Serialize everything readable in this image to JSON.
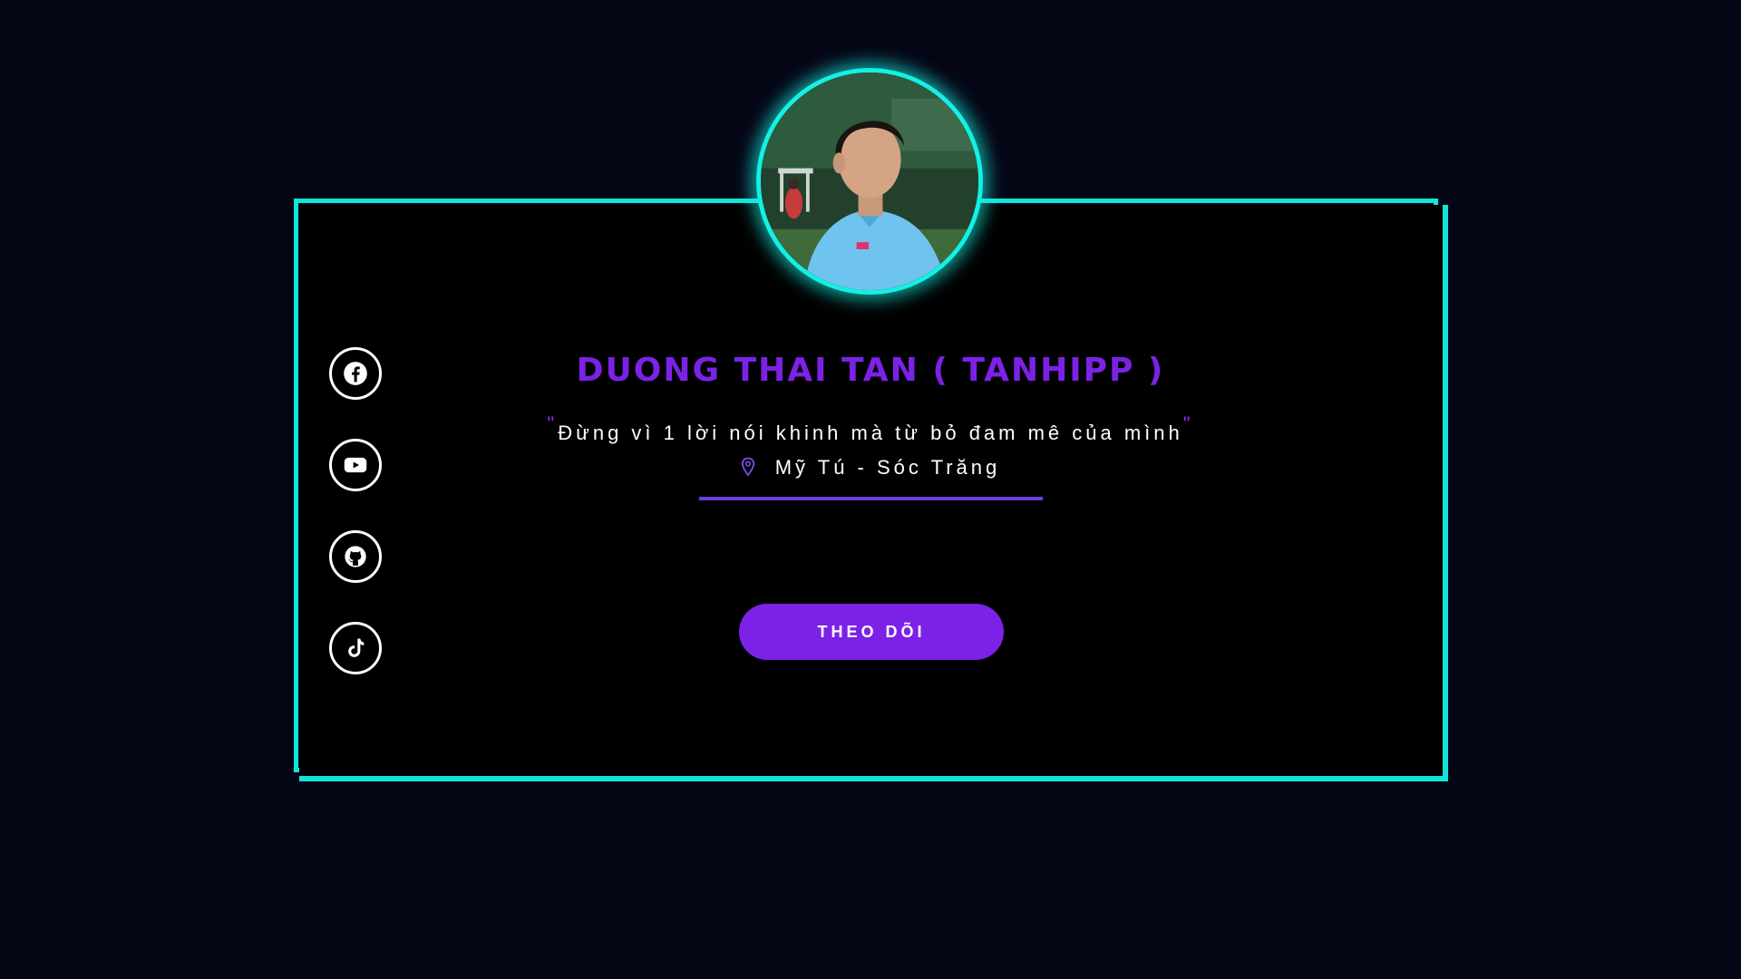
{
  "profile": {
    "name": "DUONG THAI TAN ( TANHIPP )",
    "quote_open": "\"",
    "quote": "Đừng vì 1 lời nói khinh mà từ bỏ đam mê của mình",
    "quote_close": "\"",
    "location": "Mỹ Tú - Sóc Trăng",
    "follow_label": "THEO DÕI"
  },
  "social": [
    {
      "name": "facebook-icon"
    },
    {
      "name": "youtube-icon"
    },
    {
      "name": "github-icon"
    },
    {
      "name": "tiktok-icon"
    }
  ],
  "colors": {
    "background": "#050615",
    "card": "#000000",
    "border": "#12e5d8",
    "accent": "#7b22e6"
  }
}
